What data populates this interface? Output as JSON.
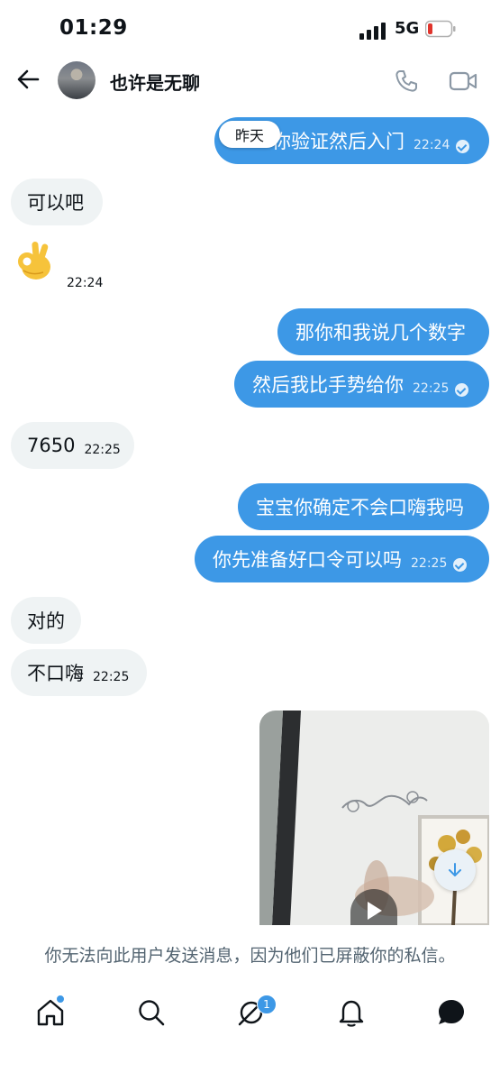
{
  "status_bar": {
    "time": "01:29",
    "network": "5G"
  },
  "header": {
    "title": "也许是无聊"
  },
  "date_chip": "昨天",
  "messages": [
    {
      "text": "你验证然后入门",
      "time": "22:24"
    },
    {
      "text": "可以吧"
    },
    {
      "emoji": "ok-hand",
      "time": "22:24"
    },
    {
      "text": "那你和我说几个数字"
    },
    {
      "text": "然后我比手势给你",
      "time": "22:25"
    },
    {
      "text": "7650",
      "time": "22:25"
    },
    {
      "text": "宝宝你确定不会口嗨我吗"
    },
    {
      "text": "你先准备好口令可以吗",
      "time": "22:25"
    },
    {
      "text": "对的"
    },
    {
      "text": "不口嗨",
      "time": "22:25"
    }
  ],
  "blocked_notice": "你无法向此用户发送消息，因为他们已屏蔽你的私信。",
  "nav": {
    "messages_badge": "1"
  },
  "colors": {
    "accent": "#3d98e6",
    "incoming": "#eff3f4"
  }
}
